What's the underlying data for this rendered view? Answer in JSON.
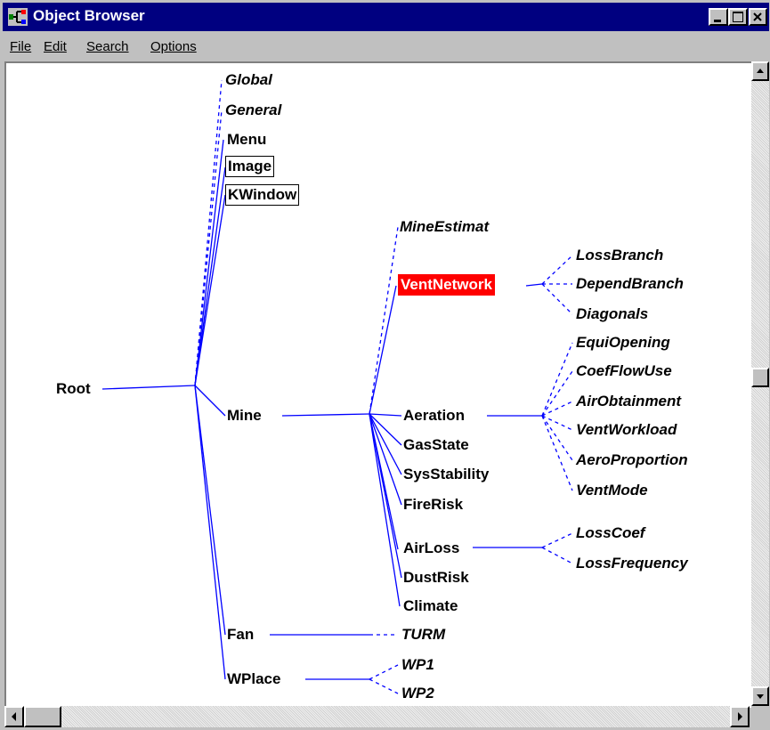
{
  "window": {
    "title": "Object Browser"
  },
  "menu": [
    {
      "label": "File"
    },
    {
      "label": "Edit"
    },
    {
      "label": "Search"
    },
    {
      "label": "Options"
    }
  ],
  "tree": {
    "root": "Root",
    "top_level": [
      "Global",
      "General",
      "Menu",
      "Image",
      "KWindow",
      "Mine",
      "Fan",
      "WPlace"
    ],
    "mine_children": [
      "MineEstimat",
      "VentNetwork",
      "Aeration",
      "GasState",
      "SysStability",
      "FireRisk",
      "AirLoss",
      "DustRisk",
      "Climate"
    ],
    "ventnetwork_children": [
      "LossBranch",
      "DependBranch",
      "Diagonals"
    ],
    "aeration_children": [
      "EquiOpening",
      "CoefFlowUse",
      "AirObtainment",
      "VentWorkload",
      "AeroProportion",
      "VentMode"
    ],
    "airloss_children": [
      "LossCoef",
      "LossFrequency"
    ],
    "fan_children": [
      "TURM"
    ],
    "wplace_children": [
      "WP1",
      "WP2"
    ],
    "selected": "VentNetwork",
    "selected_color": "#ff0000",
    "link_color": "#0000ff"
  },
  "colors": {
    "titlebar": "#000080",
    "window_bg": "#c0c0c0"
  }
}
